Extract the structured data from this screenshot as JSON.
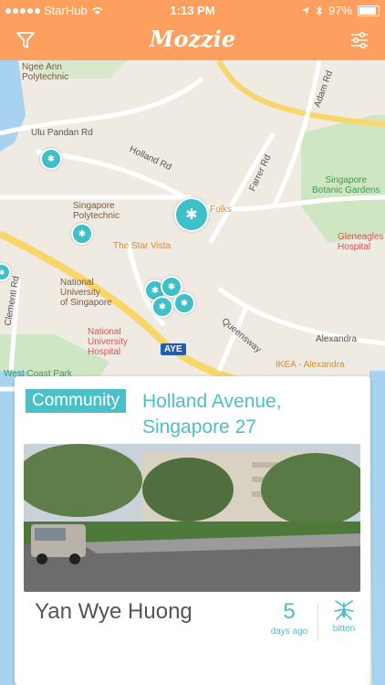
{
  "status_bar": {
    "carrier": "StarHub",
    "time": "1:13 PM",
    "battery": "97%"
  },
  "nav": {
    "title": "Mozzie",
    "left_icon": "filter-icon",
    "right_icon": "settings-sliders-icon"
  },
  "map": {
    "labels": {
      "ngee_ann": "Ngee Ann\nPolytechnic",
      "ulu_pandan": "Ulu Pandan Rd",
      "holland_rd": "Holland Rd",
      "farrer_rd": "Farrer Rd",
      "adam_rd": "Adam Rd",
      "sg_poly": "Singapore\nPolytechnic",
      "star_vista": "The Star Vista",
      "folks": "Folks",
      "botanic": "Singapore\nBotanic Gardens",
      "gleneagles": "Gleneagles\nHospital",
      "nus": "National\nUniversity\nof Singapore",
      "nuh": "National\nUniversity\nHospital",
      "clementi": "Clementi Rd",
      "queensway": "Queensway",
      "alexandra": "Alexandra",
      "aye": "AYE",
      "ikea": "IKEA - Alexandra",
      "west_coast": "West Coast Park"
    }
  },
  "card": {
    "badge": "Community",
    "address": "Holland Avenue, Singapore 27",
    "reporter": "Yan Wye Huong",
    "days_count": "5",
    "days_label": "days ago",
    "status_label": "bitten",
    "status_icon": "mosquito-icon"
  },
  "colors": {
    "accent": "#fda05f",
    "teal": "#4bc0c8"
  }
}
